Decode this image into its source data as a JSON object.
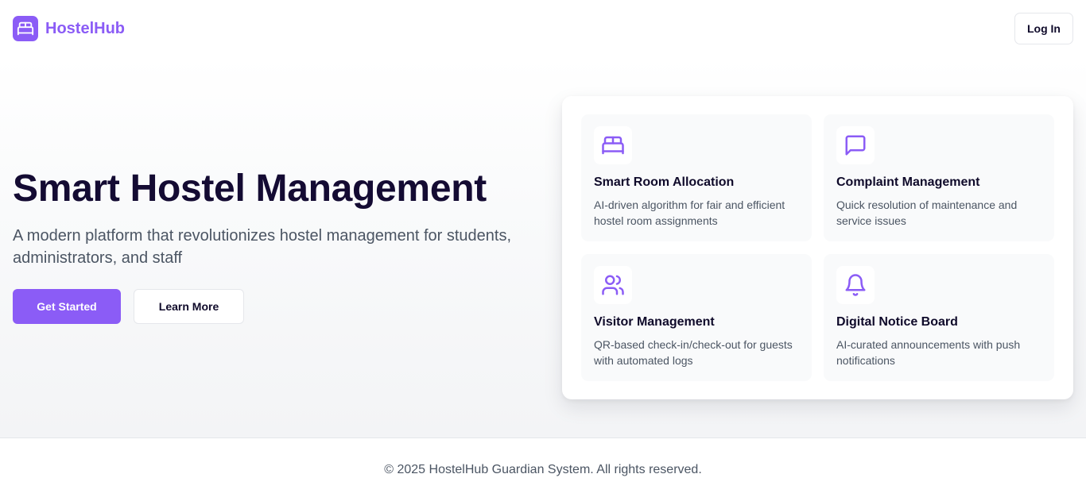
{
  "header": {
    "brand_name": "HostelHub",
    "brand_icon": "bed-icon",
    "login_label": "Log In"
  },
  "hero": {
    "title": "Smart Hostel Management",
    "subtitle": "A modern platform that revolutionizes hostel management for students, administrators, and staff",
    "primary_cta": "Get Started",
    "secondary_cta": "Learn More"
  },
  "features": [
    {
      "icon": "bed-icon",
      "title": "Smart Room Allocation",
      "description": "AI-driven algorithm for fair and efficient hostel room assignments"
    },
    {
      "icon": "message-square-icon",
      "title": "Complaint Management",
      "description": "Quick resolution of maintenance and service issues"
    },
    {
      "icon": "users-icon",
      "title": "Visitor Management",
      "description": "QR-based check-in/check-out for guests with automated logs"
    },
    {
      "icon": "bell-icon",
      "title": "Digital Notice Board",
      "description": "AI-curated announcements with push notifications"
    }
  ],
  "footer": {
    "copyright": "© 2025 HostelHub Guardian System. All rights reserved."
  },
  "colors": {
    "accent": "#8b5cf6",
    "heading": "#140b33",
    "body_text": "#4b5563",
    "card_bg": "#f9fafb",
    "border": "#e5e7eb"
  }
}
